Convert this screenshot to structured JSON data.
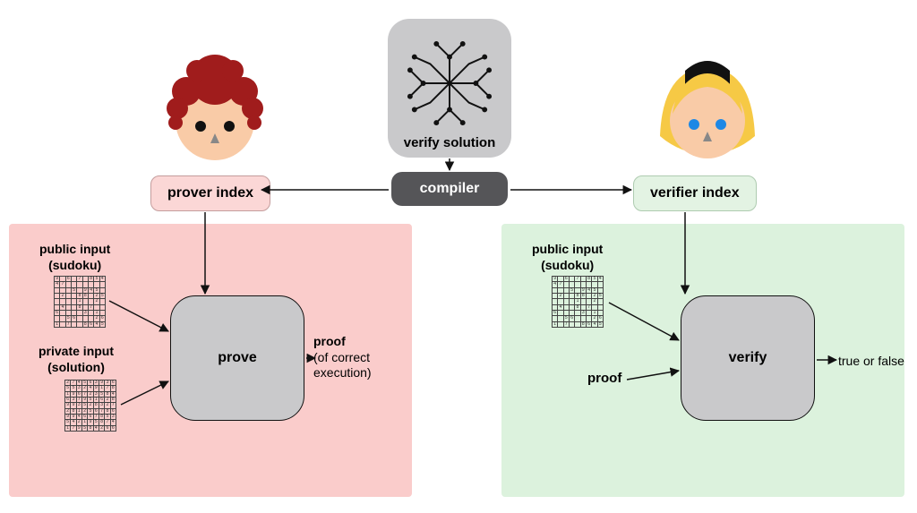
{
  "top": {
    "label": "verify solution"
  },
  "compiler": {
    "label": "compiler"
  },
  "indices": {
    "prover": "prover index",
    "verifier": "verifier index"
  },
  "boxes": {
    "prove": "prove",
    "verify": "verify"
  },
  "labels": {
    "public1": "public input",
    "public2": "(sudoku)",
    "private1": "private input",
    "private2": "(solution)",
    "proof": "proof"
  },
  "outputs": {
    "proof1": "proof",
    "proof2": "(of correct",
    "proof3": "execution)",
    "tf": "true or false"
  },
  "sudoku_public": [
    [
      "9",
      "",
      "6",
      "",
      "7",
      "",
      "8",
      "5",
      "4"
    ],
    [
      "4",
      "7",
      "",
      "",
      "",
      "",
      "",
      "",
      ""
    ],
    [
      "",
      "",
      "",
      "5",
      "",
      "9",
      "4",
      "5",
      "",
      "2"
    ],
    [
      "",
      "2",
      "",
      "",
      "8",
      "8",
      "",
      "2",
      "5",
      "1"
    ],
    [
      "",
      "",
      "",
      "",
      "1",
      "",
      "",
      "2",
      "",
      "6",
      "1"
    ],
    [
      "",
      "4",
      "",
      "",
      "8",
      "",
      "7",
      "",
      ""
    ],
    [
      "6",
      "",
      "",
      "",
      "",
      "3",
      "",
      "1",
      ""
    ],
    [
      "",
      "",
      "5",
      "6",
      "",
      "",
      "",
      "2",
      "6",
      ""
    ],
    [
      "1",
      "",
      "7",
      "",
      "",
      "8",
      "6",
      "4",
      "5"
    ]
  ],
  "sudoku_private": [
    [
      "2",
      "7",
      "4",
      "5",
      "6",
      "3",
      "9",
      "3",
      "6"
    ],
    [
      "5",
      "5",
      "3",
      "2",
      "4",
      "9",
      "1",
      "7",
      "8"
    ],
    [
      "1",
      "9",
      "6",
      "7",
      "2",
      "3",
      "5",
      "8",
      "4"
    ],
    [
      "6",
      "3",
      "7",
      "9",
      "5",
      "1",
      "6",
      "2",
      "8"
    ],
    [
      "9",
      "9",
      "3",
      "5",
      "2",
      "8",
      "3",
      "2",
      "7",
      "4"
    ],
    [
      "2",
      "8",
      "1",
      "2",
      "5",
      "6",
      "7",
      "8",
      "6"
    ],
    [
      "9",
      "9",
      "4",
      "6",
      "6",
      "7",
      "8",
      "5",
      "3"
    ],
    [
      "5",
      "4",
      "2",
      "1",
      "9",
      "5",
      "8",
      "7",
      "4",
      "6"
    ],
    [
      "1",
      "7",
      "9",
      "5",
      "8",
      "4",
      "2",
      "6",
      "6"
    ]
  ],
  "icons": {
    "circuit": "circuit-icon",
    "prover_avatar": "red-hair-avatar",
    "verifier_avatar": "blonde-hair-avatar"
  }
}
